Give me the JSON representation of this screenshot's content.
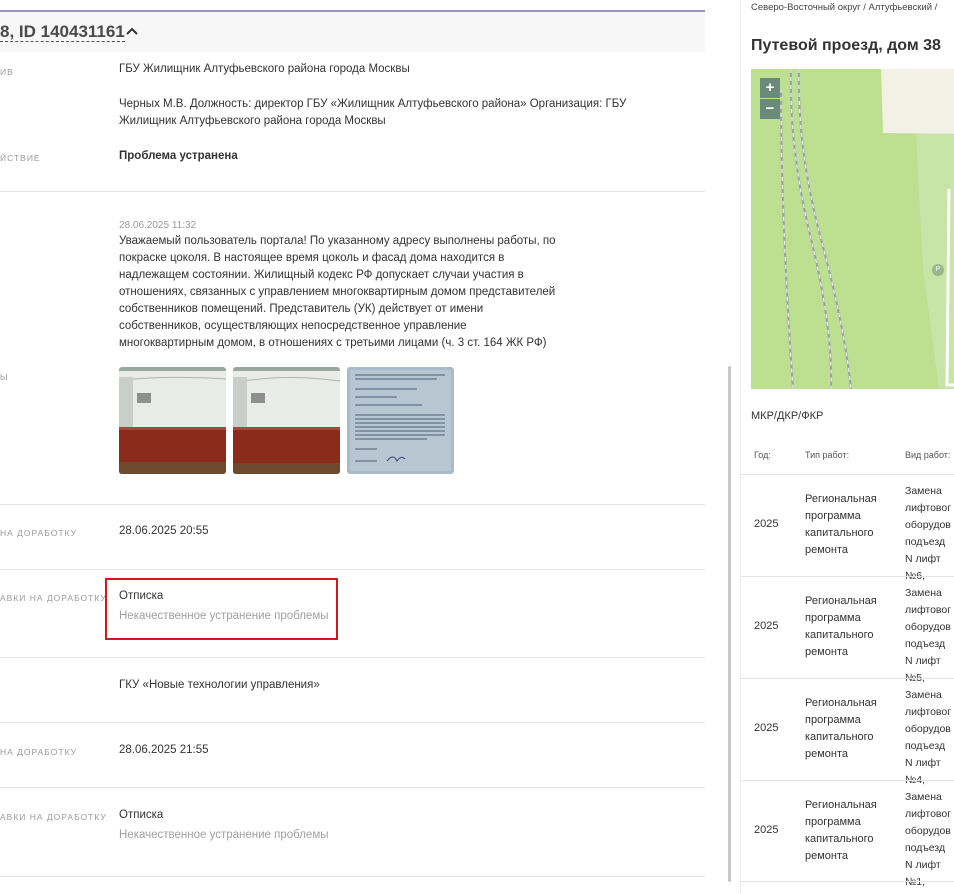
{
  "header": {
    "title": "8, ID 140431161"
  },
  "rows": {
    "executor_label": "ИВ",
    "executor_org": "ГБУ Жилищник Алтуфьевского района города Москвы",
    "executor_person": "Черных М.В. Должность: директор ГБУ «Жилищник Алтуфьевского района» Организация: ГБУ Жилищник Алтуфьевского района города Москвы",
    "action_label": "ЙСТВИЕ",
    "action_value": "Проблема устранена",
    "answer_date": "28.06.2025 11:32",
    "answer_text": "Уважаемый пользователь портала! По указанному адресу выполнены работы, по покраске цоколя. В настоящее время цоколь и фасад дома находится в надлежащем состоянии. Жилищный кодекс РФ допускает случаи участия в отношениях, связанных с управлением многоквартирным домом представителей собственников помещений. Представитель (УК) действует от имени собственников, осуществляющих непосредственное управление многоквартирным домом, в отношениях с третьими лицами (ч. 3 ст. 164 ЖК РФ)",
    "photos_label": "Ы",
    "return_date_label": "НА ДОРАБОТКУ",
    "return_date_value": "28.06.2025 20:55",
    "return_reason_label": "АВКИ НА ДОРАБОТКУ",
    "return_reason_value": "Отписка",
    "return_reason_sub": "Некачественное устранение проблемы",
    "org_value": "ГКУ «Новые технологии управления»",
    "return_date2_label": "НА ДОРАБОТКУ",
    "return_date2_value": "28.06.2025 21:55",
    "return_reason2_label": "АВКИ НА ДОРАБОТКУ",
    "return_reason2_value": "Отписка",
    "return_reason2_sub": "Некачественное устранение проблемы"
  },
  "right": {
    "breadcrumb": "Северо-Восточный округ / Алтуфьевский /",
    "address": "Путевой проезд, дом 38",
    "zoom_in": "+",
    "zoom_out": "−",
    "map_marker": "P",
    "section_title": "МКР/ДКР/ФКР",
    "table_headers": [
      "Год:",
      "Тип работ:",
      "Вид работ:"
    ],
    "table_rows": [
      {
        "year": "2025",
        "type": "Региональная программа капитального ремонта",
        "kind": "Замена лифтовог оборудов подъезд N лифт №6,"
      },
      {
        "year": "2025",
        "type": "Региональная программа капитального ремонта",
        "kind": "Замена лифтовог оборудов подъезд N лифт №5,"
      },
      {
        "year": "2025",
        "type": "Региональная программа капитального ремонта",
        "kind": "Замена лифтовог оборудов подъезд N лифт №4,"
      },
      {
        "year": "2025",
        "type": "Региональная программа капитального ремонта",
        "kind": "Замена лифтовог оборудов подъезд N лифт №1,"
      }
    ]
  },
  "colors": {
    "accent_line": "#9690c4",
    "highlight": "#d0181e"
  }
}
